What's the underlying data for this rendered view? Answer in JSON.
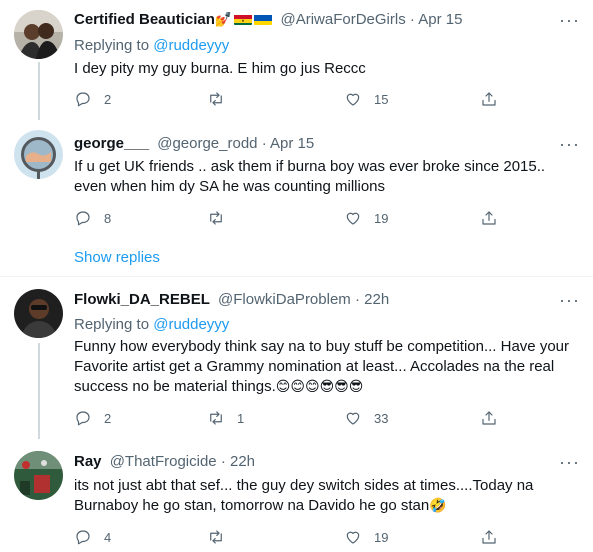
{
  "tweets": [
    {
      "name": "Certified Beautician",
      "name_emoji": "💅",
      "handle": "@AriwaForDeGirls",
      "time": "Apr 15",
      "replying_label": "Replying to",
      "replying_to": "@ruddeyyy",
      "text": "I dey pity my guy burna. E him go jus Reccc",
      "replies": "2",
      "retweets": "",
      "likes": "15"
    },
    {
      "name": "george___",
      "handle": "@george_rodd",
      "time": "Apr 15",
      "text": "If u get UK friends .. ask them if burna boy was ever broke since 2015.. even when him dy SA he was counting millions",
      "replies": "8",
      "retweets": "",
      "likes": "19",
      "show_replies": "Show replies"
    },
    {
      "name": "Flowki_DA_REBEL",
      "handle": "@FlowkiDaProblem",
      "time": "22h",
      "replying_label": "Replying to",
      "replying_to": "@ruddeyyy",
      "text": "Funny how everybody think say na to buy stuff be competition... Have your Favorite artist get a Grammy nomination at least... Accolades na the real success no be material things.",
      "text_emoji": "😊😊😊😎😎😎",
      "replies": "2",
      "retweets": "1",
      "likes": "33"
    },
    {
      "name": "Ray",
      "handle": "@ThatFrogicide",
      "time": "22h",
      "text": "its not just abt that sef... the guy dey switch sides at times....Today na Burnaboy he go stan, tomorrow na Davido he go stan",
      "text_emoji": "🤣",
      "replies": "4",
      "retweets": "",
      "likes": "19"
    }
  ],
  "dot": "·",
  "colors": {
    "link": "#1d9bf0",
    "muted": "#536471",
    "text": "#0f1419"
  }
}
